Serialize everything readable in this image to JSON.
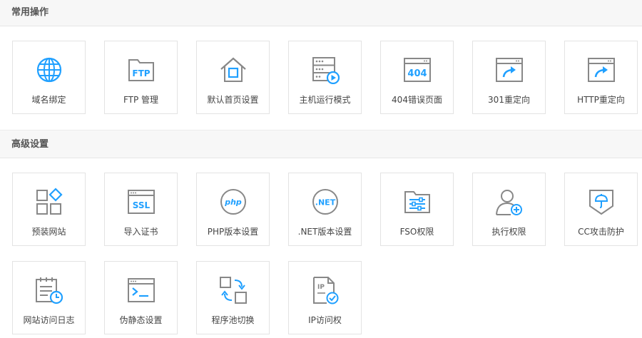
{
  "sections": [
    {
      "title": "常用操作",
      "items": [
        {
          "label": "域名绑定",
          "icon": "globe-icon"
        },
        {
          "label": "FTP 管理",
          "icon": "ftp-folder-icon"
        },
        {
          "label": "默认首页设置",
          "icon": "home-icon"
        },
        {
          "label": "主机运行模式",
          "icon": "server-play-icon"
        },
        {
          "label": "404错误页面",
          "icon": "error-404-icon"
        },
        {
          "label": "301重定向",
          "icon": "redirect-301-icon"
        },
        {
          "label": "HTTP重定向",
          "icon": "redirect-http-icon"
        }
      ]
    },
    {
      "title": "高级设置",
      "items": [
        {
          "label": "预装网站",
          "icon": "preinstall-apps-icon"
        },
        {
          "label": "导入证书",
          "icon": "ssl-certificate-icon"
        },
        {
          "label": "PHP版本设置",
          "icon": "php-icon"
        },
        {
          "label": ".NET版本设置",
          "icon": "dotnet-icon"
        },
        {
          "label": "FSO权限",
          "icon": "fso-folder-icon"
        },
        {
          "label": "执行权限",
          "icon": "user-add-icon"
        },
        {
          "label": "CC攻击防护",
          "icon": "shield-umbrella-icon"
        },
        {
          "label": "网站访问日志",
          "icon": "log-calendar-icon"
        },
        {
          "label": "伪静态设置",
          "icon": "terminal-icon"
        },
        {
          "label": "程序池切换",
          "icon": "pool-switch-icon"
        },
        {
          "label": "IP访问权",
          "icon": "ip-access-icon"
        }
      ]
    }
  ],
  "colors": {
    "accent": "#20a0ff",
    "icon_gray": "#888888",
    "border": "#e3e3e3"
  }
}
